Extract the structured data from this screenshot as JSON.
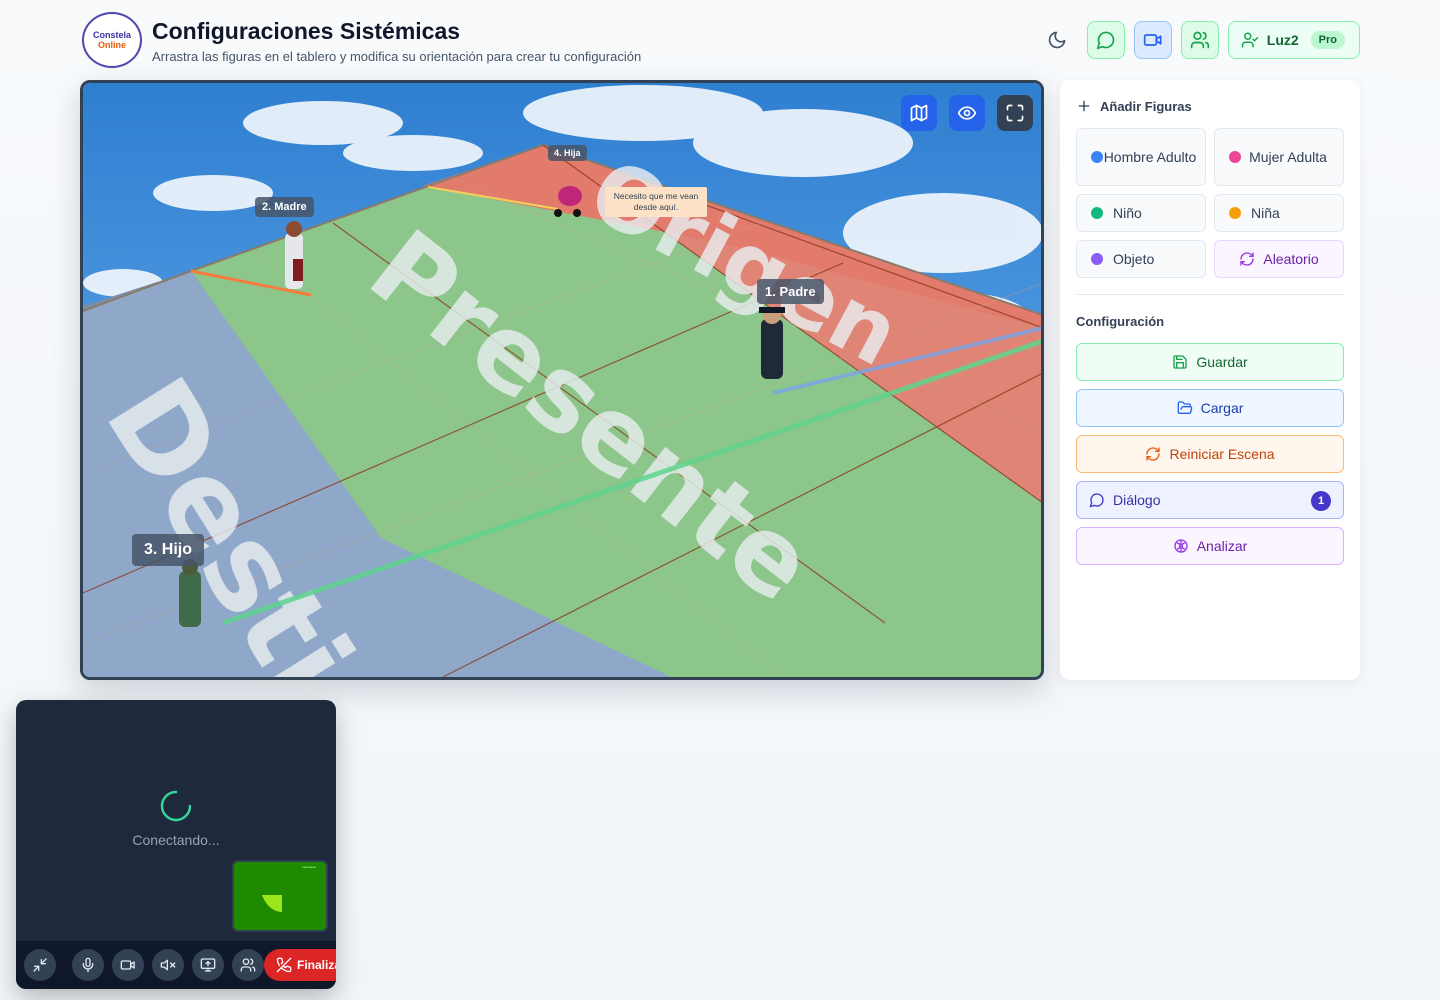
{
  "header": {
    "logo_line1": "Constela",
    "logo_line2": "Online",
    "title": "Configuraciones Sistémicas",
    "subtitle": "Arrastra las figuras en el tablero y modifica su orientación para crear tu configuración",
    "user_name": "Luz2",
    "plan_badge": "Pro"
  },
  "scene": {
    "zones": [
      "Origen",
      "Presente",
      "Destino"
    ],
    "figures": [
      {
        "label": "1. Padre"
      },
      {
        "label": "2. Madre"
      },
      {
        "label": "3. Hijo"
      },
      {
        "label": "4. Hija"
      }
    ],
    "speech_bubble": "Necesito que me vean desde aquí.",
    "controls": [
      "map-icon",
      "eye-icon",
      "fullscreen-icon"
    ]
  },
  "sidebar": {
    "add_title": "Añadir Figuras",
    "figures": [
      {
        "label": "Hombre Adulto",
        "color": "#3b82f6"
      },
      {
        "label": "Mujer Adulta",
        "color": "#ec4899"
      },
      {
        "label": "Niño",
        "color": "#10b981"
      },
      {
        "label": "Niña",
        "color": "#f59e0b"
      },
      {
        "label": "Objeto",
        "color": "#8b5cf6"
      }
    ],
    "random_label": "Aleatorio",
    "config_title": "Configuración",
    "actions": {
      "save": "Guardar",
      "load": "Cargar",
      "reset": "Reiniciar Escena",
      "dialog": "Diálogo",
      "dialog_count": "1",
      "analyze": "Analizar"
    }
  },
  "call": {
    "status": "Conectando...",
    "end_label": "Finalizar"
  }
}
